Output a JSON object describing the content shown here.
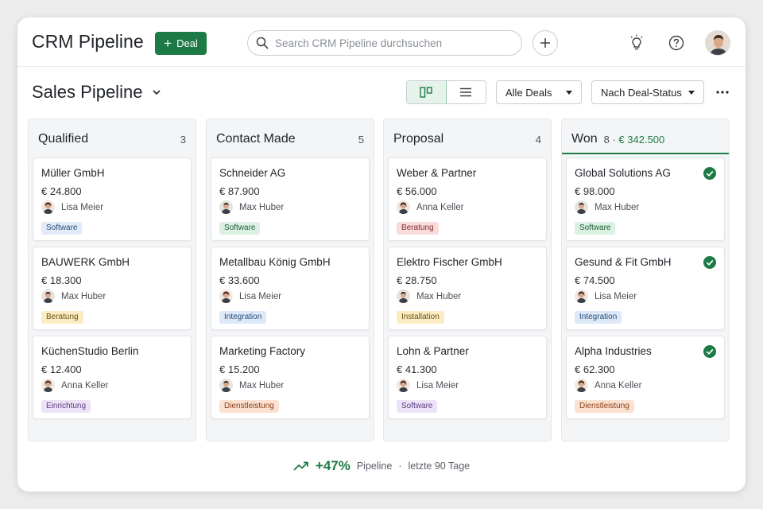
{
  "header": {
    "app_title": "CRM Pipeline",
    "new_deal_label": "Deal",
    "search_placeholder": "Search CRM Pipeline durchsuchen"
  },
  "toolbar": {
    "page_title": "Sales Pipeline",
    "filter_label": "Alle Deals",
    "group_label": "Nach Deal-Status"
  },
  "colors": {
    "accent": "#1e7a45",
    "column_bg": "#f4f5f6"
  },
  "columns": [
    {
      "name": "Qualified",
      "count": "3",
      "cards": [
        {
          "name": "Müller GmbH",
          "amount": "€ 24.800",
          "owner": "Lisa Meier",
          "tag": "Software"
        },
        {
          "name": "BAUWERK GmbH",
          "amount": "€ 18.300",
          "owner": "Max Huber",
          "tag": "Beratung"
        },
        {
          "name": "KüchenStudio Berlin",
          "amount": "€ 12.400",
          "owner": "Anna Keller",
          "tag": "Einrichtung"
        }
      ]
    },
    {
      "name": "Contact Made",
      "count": "5",
      "cards": [
        {
          "name": "Schneider AG",
          "amount": "€ 87.900",
          "owner": "Max Huber",
          "tag": "Software"
        },
        {
          "name": "Metallbau König GmbH",
          "amount": "€ 33.600",
          "owner": "Lisa Meier",
          "tag": "Integration"
        },
        {
          "name": "Marketing Factory",
          "amount": "€ 15.200",
          "owner": "Max Huber",
          "tag": "Dienstleistung"
        }
      ]
    },
    {
      "name": "Proposal",
      "count": "4",
      "cards": [
        {
          "name": "Weber & Partner",
          "amount": "€ 56.000",
          "owner": "Anna Keller",
          "tag": "Beratung"
        },
        {
          "name": "Elektro Fischer GmbH",
          "amount": "€ 28.750",
          "owner": "Max Huber",
          "tag": "Installation"
        },
        {
          "name": "Lohn & Partner",
          "amount": "€ 41.300",
          "owner": "Lisa Meier",
          "tag": "Software"
        }
      ]
    },
    {
      "name": "Won",
      "count": "8",
      "total": "€ 342.500",
      "cards": [
        {
          "name": "Global Solutions AG",
          "amount": "€ 98.000",
          "owner": "Max Huber",
          "tag": "Software"
        },
        {
          "name": "Gesund & Fit GmbH",
          "amount": "€ 74.500",
          "owner": "Lisa Meier",
          "tag": "Integration"
        },
        {
          "name": "Alpha Industries",
          "amount": "€ 62.300",
          "owner": "Anna Keller",
          "tag": "Dienstleistung"
        }
      ]
    }
  ],
  "footer": {
    "growth": "+47%",
    "label": "Pipeline",
    "separator": "·",
    "period": "letzte 90 Tage"
  }
}
